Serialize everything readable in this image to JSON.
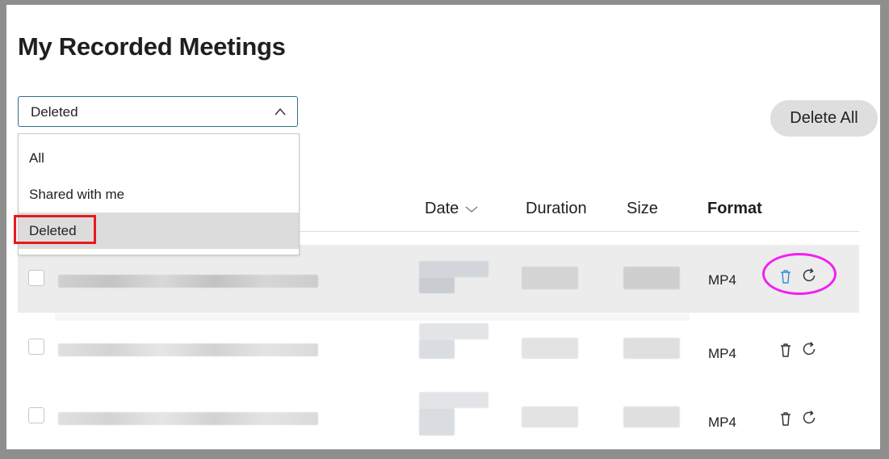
{
  "page": {
    "title": "My Recorded Meetings"
  },
  "filter": {
    "selected": "Deleted",
    "options": [
      "All",
      "Shared with me",
      "Deleted"
    ]
  },
  "toolbar": {
    "delete_all_label": "Delete All"
  },
  "table": {
    "headers": {
      "date": "Date",
      "duration": "Duration",
      "size": "Size",
      "format": "Format"
    },
    "rows": [
      {
        "format": "MP4",
        "hovered": true
      },
      {
        "format": "MP4",
        "hovered": false
      },
      {
        "format": "MP4",
        "hovered": false
      }
    ]
  },
  "icons": {
    "dropdown_chevron": "chevron-up-icon",
    "sort": "chevron-down-icon",
    "delete": "trash-icon",
    "restore": "restore-icon"
  },
  "colors": {
    "accent_border": "#2e6f86",
    "highlight_red": "#e8191d",
    "highlight_magenta": "#f21ff2",
    "trash_hover": "#3a8fd0"
  }
}
